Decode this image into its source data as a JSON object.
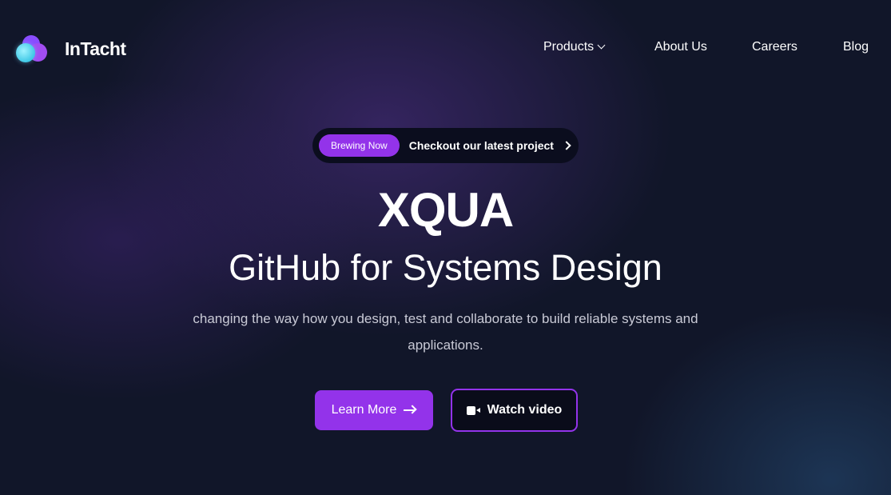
{
  "brand": {
    "name": "InTacht",
    "logo_icon": "overlapping-circles-logo"
  },
  "nav": {
    "items": [
      {
        "label": "Products",
        "has_dropdown": true
      },
      {
        "label": "About Us"
      },
      {
        "label": "Careers"
      },
      {
        "label": "Blog"
      }
    ]
  },
  "announcement": {
    "badge": "Brewing Now",
    "text": "Checkout our latest project",
    "icon": "chevron-right-icon"
  },
  "hero": {
    "title": "XQUA",
    "subtitle": "GitHub for Systems Design",
    "description": "changing the way how you design, test and collaborate to build reliable systems and applications."
  },
  "cta": {
    "primary_label": "Learn More",
    "primary_icon": "arrow-right-icon",
    "secondary_label": "Watch video",
    "secondary_icon": "video-camera-icon"
  },
  "colors": {
    "background": "#111629",
    "accent": "#9333ea",
    "text": "#ffffff",
    "muted_text": "#c9cad6"
  }
}
